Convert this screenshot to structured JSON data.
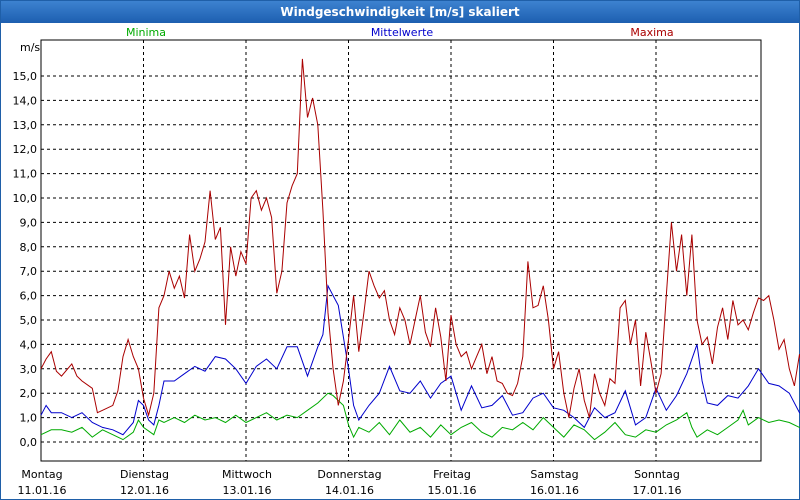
{
  "window": {
    "title": "Windgeschwindigkeit [m/s] skaliert"
  },
  "chart_data": {
    "type": "line",
    "title": "Windgeschwindigkeit [m/s] skaliert",
    "ylabel": "m/s",
    "xlabel": "",
    "ylim": [
      0,
      16.5
    ],
    "y_ticks": [
      "0,0",
      "1,0",
      "2,0",
      "3,0",
      "4,0",
      "5,0",
      "6,0",
      "7,0",
      "8,0",
      "9,0",
      "10,0",
      "11,0",
      "12,0",
      "13,0",
      "14,0",
      "15,0"
    ],
    "x_labels": [
      {
        "day": "Montag",
        "date": "11.01.16"
      },
      {
        "day": "Dienstag",
        "date": "12.01.16"
      },
      {
        "day": "Mittwoch",
        "date": "13.01.16"
      },
      {
        "day": "Donnerstag",
        "date": "14.01.16"
      },
      {
        "day": "Freitag",
        "date": "15.01.16"
      },
      {
        "day": "Samstag",
        "date": "16.01.16"
      },
      {
        "day": "Sonntag",
        "date": "17.01.16"
      }
    ],
    "grid": true,
    "x_start": "2016-01-11",
    "x_end": "2016-01-18",
    "series": [
      {
        "name": "Minima",
        "color": "#00aa00",
        "values": [
          [
            0.0,
            0.3
          ],
          [
            0.1,
            0.5
          ],
          [
            0.2,
            0.5
          ],
          [
            0.3,
            0.4
          ],
          [
            0.4,
            0.6
          ],
          [
            0.5,
            0.2
          ],
          [
            0.6,
            0.5
          ],
          [
            0.7,
            0.3
          ],
          [
            0.8,
            0.1
          ],
          [
            0.9,
            0.4
          ],
          [
            0.95,
            0.9
          ],
          [
            1.0,
            0.6
          ],
          [
            1.1,
            0.3
          ],
          [
            1.15,
            0.9
          ],
          [
            1.2,
            0.8
          ],
          [
            1.3,
            1.0
          ],
          [
            1.4,
            0.8
          ],
          [
            1.5,
            1.1
          ],
          [
            1.6,
            0.9
          ],
          [
            1.7,
            1.0
          ],
          [
            1.8,
            0.8
          ],
          [
            1.9,
            1.1
          ],
          [
            2.0,
            0.8
          ],
          [
            2.1,
            1.0
          ],
          [
            2.2,
            1.2
          ],
          [
            2.3,
            0.9
          ],
          [
            2.4,
            1.1
          ],
          [
            2.5,
            1.0
          ],
          [
            2.6,
            1.3
          ],
          [
            2.7,
            1.6
          ],
          [
            2.8,
            2.0
          ],
          [
            2.85,
            1.9
          ],
          [
            2.95,
            1.5
          ],
          [
            3.0,
            0.7
          ],
          [
            3.05,
            0.2
          ],
          [
            3.1,
            0.6
          ],
          [
            3.2,
            0.4
          ],
          [
            3.3,
            0.8
          ],
          [
            3.4,
            0.3
          ],
          [
            3.5,
            0.9
          ],
          [
            3.6,
            0.4
          ],
          [
            3.7,
            0.6
          ],
          [
            3.8,
            0.2
          ],
          [
            3.9,
            0.7
          ],
          [
            4.0,
            0.3
          ],
          [
            4.1,
            0.6
          ],
          [
            4.2,
            0.8
          ],
          [
            4.3,
            0.4
          ],
          [
            4.4,
            0.2
          ],
          [
            4.5,
            0.6
          ],
          [
            4.6,
            0.5
          ],
          [
            4.7,
            0.8
          ],
          [
            4.8,
            0.5
          ],
          [
            4.9,
            1.0
          ],
          [
            5.0,
            0.6
          ],
          [
            5.1,
            0.2
          ],
          [
            5.2,
            0.7
          ],
          [
            5.3,
            0.5
          ],
          [
            5.4,
            0.1
          ],
          [
            5.5,
            0.4
          ],
          [
            5.6,
            0.8
          ],
          [
            5.7,
            0.3
          ],
          [
            5.8,
            0.2
          ],
          [
            5.9,
            0.5
          ],
          [
            6.0,
            0.4
          ],
          [
            6.1,
            0.7
          ],
          [
            6.2,
            0.9
          ],
          [
            6.3,
            1.2
          ],
          [
            6.35,
            0.6
          ],
          [
            6.4,
            0.2
          ],
          [
            6.5,
            0.5
          ],
          [
            6.6,
            0.3
          ],
          [
            6.7,
            0.6
          ],
          [
            6.8,
            0.9
          ],
          [
            6.85,
            1.3
          ],
          [
            6.9,
            0.7
          ],
          [
            7.0,
            1.0
          ],
          [
            7.1,
            0.8
          ],
          [
            7.2,
            0.9
          ],
          [
            7.3,
            0.8
          ],
          [
            7.4,
            0.6
          ],
          [
            7.5,
            0.5
          ],
          [
            7.55,
            0.1
          ]
        ]
      },
      {
        "name": "Mittelwerte",
        "color": "#0000cc",
        "values": [
          [
            0.0,
            1.1
          ],
          [
            0.05,
            1.5
          ],
          [
            0.1,
            1.2
          ],
          [
            0.2,
            1.2
          ],
          [
            0.3,
            1.0
          ],
          [
            0.4,
            1.2
          ],
          [
            0.5,
            0.8
          ],
          [
            0.6,
            0.6
          ],
          [
            0.7,
            0.5
          ],
          [
            0.8,
            0.3
          ],
          [
            0.9,
            0.8
          ],
          [
            0.95,
            1.7
          ],
          [
            1.0,
            1.5
          ],
          [
            1.05,
            0.9
          ],
          [
            1.1,
            0.7
          ],
          [
            1.15,
            1.5
          ],
          [
            1.2,
            2.5
          ],
          [
            1.3,
            2.5
          ],
          [
            1.4,
            2.8
          ],
          [
            1.5,
            3.1
          ],
          [
            1.6,
            2.9
          ],
          [
            1.7,
            3.5
          ],
          [
            1.8,
            3.4
          ],
          [
            1.9,
            3.0
          ],
          [
            2.0,
            2.4
          ],
          [
            2.1,
            3.1
          ],
          [
            2.2,
            3.4
          ],
          [
            2.3,
            3.0
          ],
          [
            2.4,
            3.9
          ],
          [
            2.5,
            3.9
          ],
          [
            2.6,
            2.7
          ],
          [
            2.7,
            3.9
          ],
          [
            2.75,
            4.4
          ],
          [
            2.8,
            6.4
          ],
          [
            2.85,
            6.0
          ],
          [
            2.9,
            5.6
          ],
          [
            3.0,
            3.0
          ],
          [
            3.05,
            1.5
          ],
          [
            3.1,
            0.9
          ],
          [
            3.2,
            1.5
          ],
          [
            3.3,
            2.0
          ],
          [
            3.4,
            3.1
          ],
          [
            3.5,
            2.1
          ],
          [
            3.6,
            2.0
          ],
          [
            3.7,
            2.5
          ],
          [
            3.8,
            1.8
          ],
          [
            3.9,
            2.4
          ],
          [
            4.0,
            2.7
          ],
          [
            4.1,
            1.3
          ],
          [
            4.2,
            2.3
          ],
          [
            4.3,
            1.4
          ],
          [
            4.4,
            1.5
          ],
          [
            4.5,
            1.9
          ],
          [
            4.6,
            1.1
          ],
          [
            4.7,
            1.2
          ],
          [
            4.8,
            1.8
          ],
          [
            4.9,
            2.0
          ],
          [
            5.0,
            1.4
          ],
          [
            5.1,
            1.3
          ],
          [
            5.2,
            1.0
          ],
          [
            5.3,
            0.6
          ],
          [
            5.4,
            1.4
          ],
          [
            5.5,
            1.0
          ],
          [
            5.6,
            1.2
          ],
          [
            5.7,
            2.1
          ],
          [
            5.8,
            0.7
          ],
          [
            5.9,
            1.0
          ],
          [
            6.0,
            2.2
          ],
          [
            6.1,
            1.3
          ],
          [
            6.2,
            1.9
          ],
          [
            6.3,
            2.8
          ],
          [
            6.4,
            4.0
          ],
          [
            6.45,
            2.5
          ],
          [
            6.5,
            1.6
          ],
          [
            6.6,
            1.5
          ],
          [
            6.7,
            1.9
          ],
          [
            6.8,
            1.8
          ],
          [
            6.9,
            2.3
          ],
          [
            7.0,
            3.0
          ],
          [
            7.1,
            2.4
          ],
          [
            7.2,
            2.3
          ],
          [
            7.3,
            2.0
          ],
          [
            7.4,
            1.2
          ],
          [
            7.5,
            1.4
          ],
          [
            7.55,
            0.8
          ]
        ]
      },
      {
        "name": "Maxima",
        "color": "#aa0000",
        "values": [
          [
            0.0,
            3.0
          ],
          [
            0.05,
            3.4
          ],
          [
            0.1,
            3.7
          ],
          [
            0.15,
            2.9
          ],
          [
            0.2,
            2.7
          ],
          [
            0.3,
            3.2
          ],
          [
            0.35,
            2.7
          ],
          [
            0.4,
            2.5
          ],
          [
            0.5,
            2.2
          ],
          [
            0.55,
            1.2
          ],
          [
            0.6,
            1.3
          ],
          [
            0.7,
            1.5
          ],
          [
            0.75,
            2.1
          ],
          [
            0.8,
            3.5
          ],
          [
            0.85,
            4.2
          ],
          [
            0.9,
            3.5
          ],
          [
            0.95,
            3.0
          ],
          [
            1.0,
            1.8
          ],
          [
            1.05,
            1.1
          ],
          [
            1.1,
            2.0
          ],
          [
            1.15,
            5.5
          ],
          [
            1.2,
            6.0
          ],
          [
            1.25,
            7.0
          ],
          [
            1.3,
            6.3
          ],
          [
            1.35,
            6.8
          ],
          [
            1.4,
            5.9
          ],
          [
            1.45,
            8.5
          ],
          [
            1.5,
            7.0
          ],
          [
            1.55,
            7.5
          ],
          [
            1.6,
            8.2
          ],
          [
            1.65,
            10.3
          ],
          [
            1.7,
            8.3
          ],
          [
            1.75,
            8.8
          ],
          [
            1.8,
            4.8
          ],
          [
            1.85,
            8.0
          ],
          [
            1.9,
            6.8
          ],
          [
            1.95,
            7.8
          ],
          [
            2.0,
            7.3
          ],
          [
            2.05,
            10.0
          ],
          [
            2.1,
            10.3
          ],
          [
            2.15,
            9.5
          ],
          [
            2.2,
            10.0
          ],
          [
            2.25,
            9.2
          ],
          [
            2.3,
            6.1
          ],
          [
            2.35,
            7.0
          ],
          [
            2.4,
            9.8
          ],
          [
            2.45,
            10.5
          ],
          [
            2.5,
            11.0
          ],
          [
            2.55,
            15.7
          ],
          [
            2.6,
            13.3
          ],
          [
            2.65,
            14.1
          ],
          [
            2.7,
            13.0
          ],
          [
            2.75,
            9.5
          ],
          [
            2.8,
            5.3
          ],
          [
            2.85,
            3.0
          ],
          [
            2.9,
            1.5
          ],
          [
            2.95,
            2.5
          ],
          [
            3.0,
            4.2
          ],
          [
            3.05,
            6.0
          ],
          [
            3.1,
            3.7
          ],
          [
            3.15,
            5.3
          ],
          [
            3.2,
            7.0
          ],
          [
            3.25,
            6.4
          ],
          [
            3.3,
            5.9
          ],
          [
            3.35,
            6.2
          ],
          [
            3.4,
            5.0
          ],
          [
            3.45,
            4.4
          ],
          [
            3.5,
            5.5
          ],
          [
            3.55,
            5.0
          ],
          [
            3.6,
            4.0
          ],
          [
            3.65,
            5.0
          ],
          [
            3.7,
            6.0
          ],
          [
            3.75,
            4.5
          ],
          [
            3.8,
            3.9
          ],
          [
            3.85,
            5.5
          ],
          [
            3.9,
            4.3
          ],
          [
            3.95,
            2.5
          ],
          [
            4.0,
            5.2
          ],
          [
            4.05,
            4.0
          ],
          [
            4.1,
            3.5
          ],
          [
            4.15,
            3.7
          ],
          [
            4.2,
            3.0
          ],
          [
            4.25,
            3.5
          ],
          [
            4.3,
            4.0
          ],
          [
            4.35,
            2.8
          ],
          [
            4.4,
            3.5
          ],
          [
            4.45,
            2.5
          ],
          [
            4.5,
            2.4
          ],
          [
            4.55,
            2.0
          ],
          [
            4.6,
            1.9
          ],
          [
            4.65,
            2.4
          ],
          [
            4.7,
            3.5
          ],
          [
            4.75,
            7.4
          ],
          [
            4.8,
            5.5
          ],
          [
            4.85,
            5.6
          ],
          [
            4.9,
            6.4
          ],
          [
            4.95,
            5.0
          ],
          [
            5.0,
            3.0
          ],
          [
            5.05,
            3.7
          ],
          [
            5.1,
            2.0
          ],
          [
            5.15,
            1.0
          ],
          [
            5.2,
            2.2
          ],
          [
            5.25,
            3.0
          ],
          [
            5.3,
            1.7
          ],
          [
            5.35,
            1.0
          ],
          [
            5.4,
            2.8
          ],
          [
            5.45,
            2.0
          ],
          [
            5.5,
            1.5
          ],
          [
            5.55,
            2.6
          ],
          [
            5.6,
            2.4
          ],
          [
            5.65,
            5.5
          ],
          [
            5.7,
            5.8
          ],
          [
            5.75,
            4.0
          ],
          [
            5.8,
            5.0
          ],
          [
            5.85,
            2.3
          ],
          [
            5.9,
            4.5
          ],
          [
            5.95,
            3.3
          ],
          [
            6.0,
            2.0
          ],
          [
            6.05,
            2.8
          ],
          [
            6.1,
            6.0
          ],
          [
            6.15,
            9.0
          ],
          [
            6.2,
            7.0
          ],
          [
            6.25,
            8.5
          ],
          [
            6.3,
            6.0
          ],
          [
            6.35,
            8.5
          ],
          [
            6.4,
            5.0
          ],
          [
            6.45,
            4.0
          ],
          [
            6.5,
            4.3
          ],
          [
            6.55,
            3.2
          ],
          [
            6.6,
            4.7
          ],
          [
            6.65,
            5.5
          ],
          [
            6.7,
            4.2
          ],
          [
            6.75,
            5.8
          ],
          [
            6.8,
            4.8
          ],
          [
            6.85,
            5.0
          ],
          [
            6.9,
            4.6
          ],
          [
            6.95,
            5.3
          ],
          [
            7.0,
            5.9
          ],
          [
            7.05,
            5.8
          ],
          [
            7.1,
            6.0
          ],
          [
            7.15,
            5.0
          ],
          [
            7.2,
            3.8
          ],
          [
            7.25,
            4.2
          ],
          [
            7.3,
            3.0
          ],
          [
            7.35,
            2.3
          ],
          [
            7.4,
            3.6
          ],
          [
            7.45,
            2.6
          ],
          [
            7.5,
            2.3
          ],
          [
            7.55,
            1.8
          ]
        ]
      }
    ]
  }
}
